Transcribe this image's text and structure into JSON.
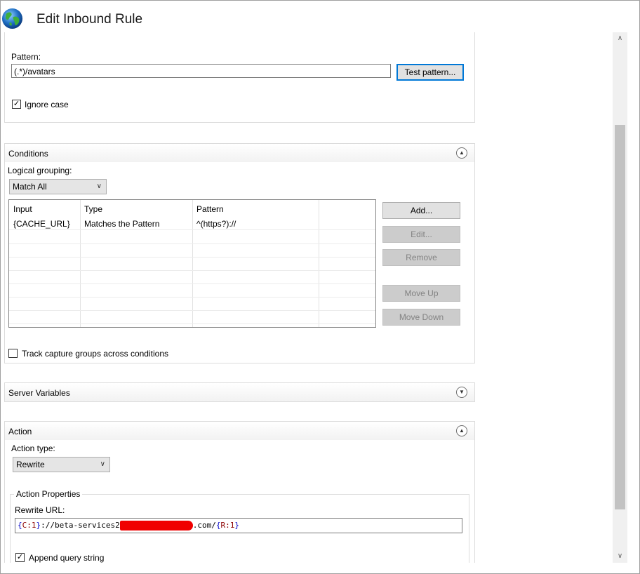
{
  "window": {
    "title": "Edit Inbound Rule",
    "icon": "globe-icon"
  },
  "match": {
    "pattern_label": "Pattern:",
    "pattern_value": "(.*)/avatars",
    "test_button": "Test pattern...",
    "ignore_case_label": "Ignore case",
    "ignore_case_checked": true
  },
  "conditions": {
    "header": "Conditions",
    "logical_grouping_label": "Logical grouping:",
    "logical_grouping_value": "Match All",
    "columns": [
      "Input",
      "Type",
      "Pattern"
    ],
    "rows": [
      {
        "input": "{CACHE_URL}",
        "type": "Matches the Pattern",
        "pattern": "^(https?)://"
      }
    ],
    "buttons": {
      "add": "Add...",
      "edit": "Edit...",
      "remove": "Remove",
      "move_up": "Move Up",
      "move_down": "Move Down"
    },
    "track_label": "Track capture groups across conditions",
    "track_checked": false
  },
  "server_variables": {
    "header": "Server Variables"
  },
  "action": {
    "header": "Action",
    "action_type_label": "Action type:",
    "action_type_value": "Rewrite",
    "properties_label": "Action Properties",
    "rewrite_url_label": "Rewrite URL:",
    "rewrite_url": {
      "part1_open": "{",
      "part1_var": "C:1",
      "part1_close": "}",
      "middle": "://beta-services2",
      "suffix": ".com/",
      "part2_open": "{",
      "part2_var": "R:1",
      "part2_close": "}"
    },
    "append_query_label": "Append query string",
    "append_query_checked": true
  },
  "colors": {
    "accent": "#0078d7",
    "redaction": "#f00000",
    "url_brace": "#0000c8",
    "url_var": "#8b0000"
  }
}
